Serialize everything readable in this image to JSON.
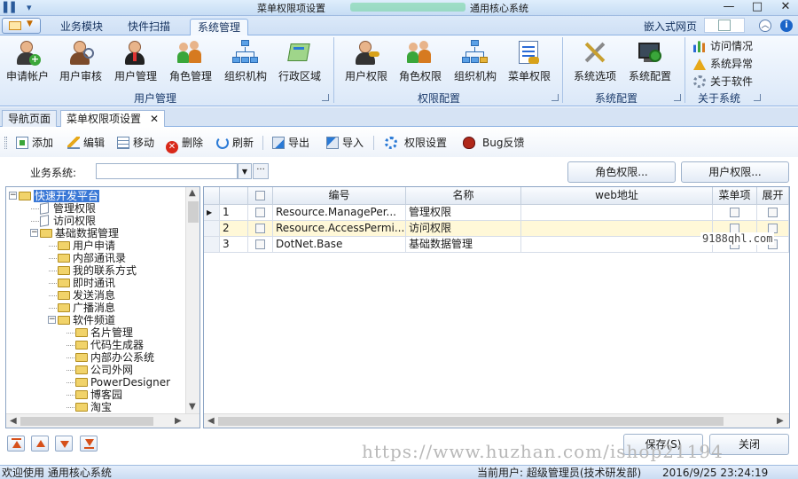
{
  "window": {
    "title_left": "菜单权限项设置",
    "title_right": "通用核心系统",
    "minimize": "—",
    "maximize": "□",
    "close": "✕"
  },
  "ribbon_tabs": [
    "业务模块",
    "快件扫描",
    "系统管理"
  ],
  "active_ribbon_tab": "系统管理",
  "embed_label": "嵌入式网页",
  "groups": {
    "user_manage": {
      "title": "用户管理",
      "buttons": [
        "申请帐户",
        "用户审核",
        "用户管理",
        "角色管理",
        "组织机构",
        "行政区域"
      ]
    },
    "permission": {
      "title": "权限配置",
      "buttons": [
        "用户权限",
        "角色权限",
        "组织机构",
        "菜单权限"
      ]
    },
    "system_config": {
      "title": "系统配置",
      "buttons": [
        "系统选项",
        "系统配置"
      ]
    },
    "about": {
      "title": "关于系统",
      "items": [
        "访问情况",
        "系统异常",
        "关于软件"
      ]
    }
  },
  "doc_tabs": [
    "导航页面",
    "菜单权限项设置"
  ],
  "doc_tab_close": "✕",
  "toolbar": [
    "添加",
    "编辑",
    "移动",
    "删除",
    "刷新",
    "导出",
    "导入",
    "权限设置",
    "Bug反馈"
  ],
  "biz": {
    "label": "业务系统:",
    "value": "",
    "more": "···",
    "role_perm_button": "角色权限...",
    "user_perm_button": "用户权限..."
  },
  "tree": [
    {
      "label": "快速开发平台",
      "level": 0,
      "type": "folder",
      "selected": true
    },
    {
      "label": "管理权限",
      "level": 1,
      "type": "doc"
    },
    {
      "label": "访问权限",
      "level": 1,
      "type": "doc"
    },
    {
      "label": "基础数据管理",
      "level": 1,
      "type": "folder"
    },
    {
      "label": "用户申请",
      "level": 2,
      "type": "folder"
    },
    {
      "label": "内部通讯录",
      "level": 2,
      "type": "folder"
    },
    {
      "label": "我的联系方式",
      "level": 2,
      "type": "folder"
    },
    {
      "label": "即时通讯",
      "level": 2,
      "type": "folder"
    },
    {
      "label": "发送消息",
      "level": 2,
      "type": "folder"
    },
    {
      "label": "广播消息",
      "level": 2,
      "type": "folder"
    },
    {
      "label": "软件频道",
      "level": 2,
      "type": "folder"
    },
    {
      "label": "名片管理",
      "level": 3,
      "type": "folder"
    },
    {
      "label": "代码生成器",
      "level": 3,
      "type": "folder"
    },
    {
      "label": "内部办公系统",
      "level": 3,
      "type": "folder"
    },
    {
      "label": "公司外网",
      "level": 3,
      "type": "folder"
    },
    {
      "label": "PowerDesigner",
      "level": 3,
      "type": "folder"
    },
    {
      "label": "博客园",
      "level": 3,
      "type": "folder"
    },
    {
      "label": "淘宝",
      "level": 3,
      "type": "folder"
    },
    {
      "label": "系统后台管理",
      "level": 2,
      "type": "folder"
    }
  ],
  "grid": {
    "columns": [
      "编号",
      "名称",
      "web地址",
      "菜单项",
      "展开"
    ],
    "rows": [
      {
        "num": "1",
        "code": "Resource.ManagePer...",
        "name": "管理权限",
        "web": "",
        "current": true
      },
      {
        "num": "2",
        "code": "Resource.AccessPermi...",
        "name": "访问权限",
        "web": "",
        "highlight": true
      },
      {
        "num": "3",
        "code": "DotNet.Base",
        "name": "基础数据管理",
        "web": ""
      }
    ]
  },
  "bottom": {
    "save": "保存(S)",
    "close": "关闭"
  },
  "status": {
    "welcome": "欢迎使用 通用核心系统",
    "current_user": "当前用户: 超级管理员(技术研发部)",
    "datetime": "2016/9/25 23:24:19"
  },
  "watermarks": {
    "side": "9188qhl.com",
    "bottom": "https://www.huzhan.com/ishop21194"
  }
}
